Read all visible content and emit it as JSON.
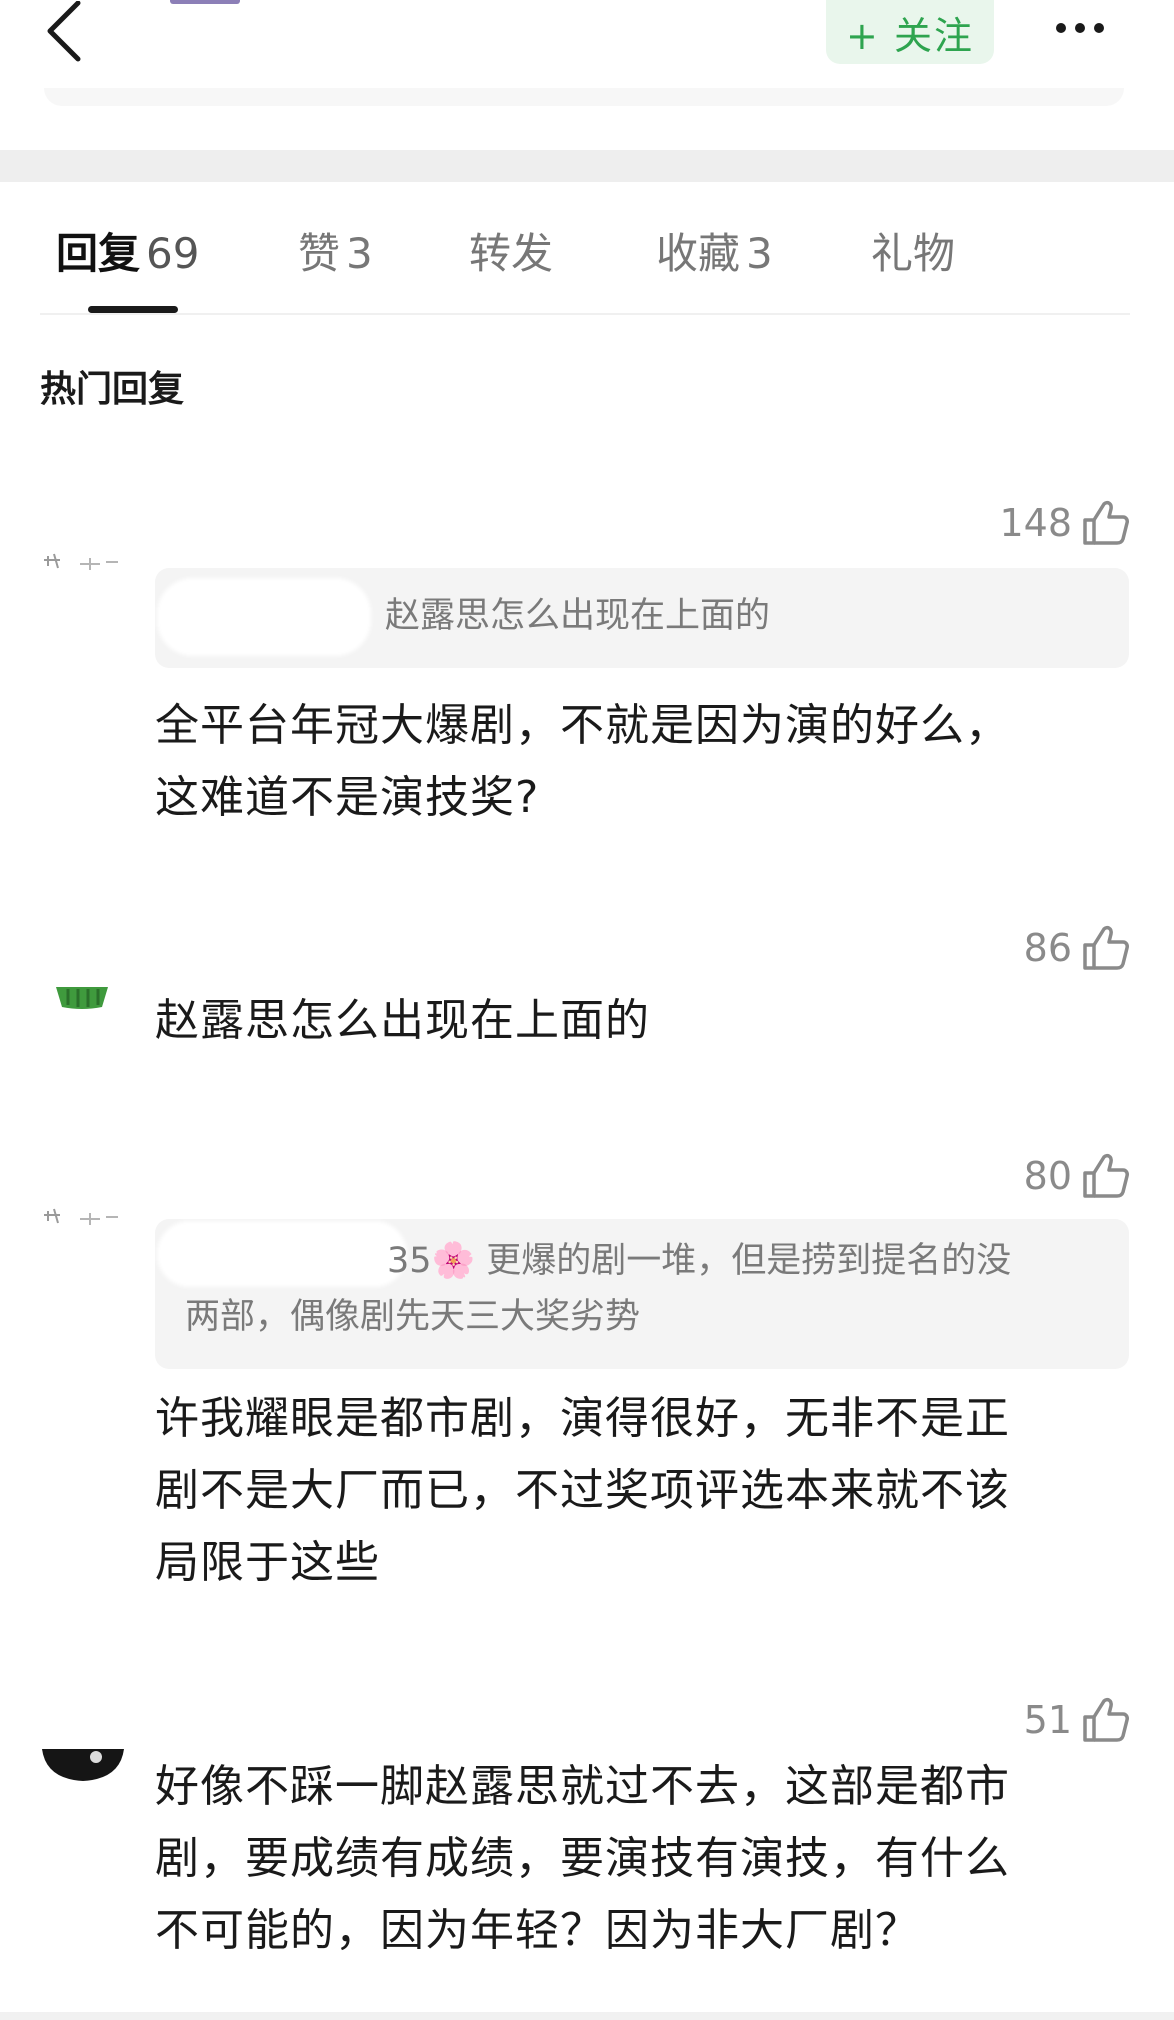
{
  "header": {
    "follow_label": "+ 关注"
  },
  "tabs": [
    {
      "label": "回复",
      "count": "69",
      "active": true
    },
    {
      "label": "赞",
      "count": "3",
      "active": false
    },
    {
      "label": "转发",
      "count": "",
      "active": false
    },
    {
      "label": "收藏",
      "count": "3",
      "active": false
    },
    {
      "label": "礼物",
      "count": "",
      "active": false
    }
  ],
  "section_title": "热门回复",
  "comments": [
    {
      "likes": "148",
      "quote": "赵露思怎么出现在上面的",
      "text_lines": [
        "全平台年冠大爆剧，不就是因为演的好么，",
        "这难道不是演技奖?"
      ]
    },
    {
      "likes": "86",
      "text_lines": [
        "赵露思怎么出现在上面的"
      ]
    },
    {
      "likes": "80",
      "quote_lines": [
        "35🌸 更爆的剧一堆，但是捞到提名的没",
        "两部，偶像剧先天三大奖劣势"
      ],
      "text_lines": [
        "许我耀眼是都市剧，演得很好，无非不是正",
        "剧不是大厂而已，不过奖项评选本来就不该",
        "局限于这些"
      ]
    },
    {
      "likes": "51",
      "text_lines": [
        "好像不踩一脚赵露思就过不去，这部是都市",
        "剧，要成绩有成绩，要演技有演技，有什么",
        "不可能的，因为年轻？因为非大厂剧？"
      ]
    }
  ],
  "colors": {
    "accent_green": "#2ea44f",
    "follow_bg": "#e9f6ec",
    "muted_text": "#8a8a8a",
    "quote_bg": "#f4f4f4"
  }
}
